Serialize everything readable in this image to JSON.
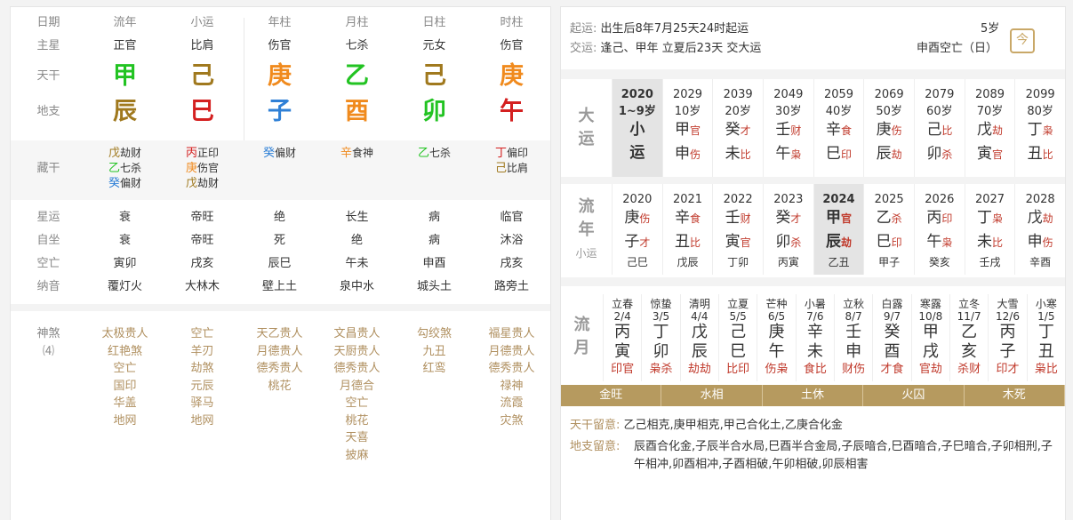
{
  "left": {
    "headers": [
      "日期",
      "流年",
      "小运",
      "年柱",
      "月柱",
      "日柱",
      "时柱"
    ],
    "zhuxing": {
      "label": "主星",
      "values": [
        "正官",
        "比肩",
        "伤官",
        "七杀",
        "元女",
        "伤官"
      ]
    },
    "tiangan": {
      "label": "天干",
      "values": [
        "甲",
        "己",
        "庚",
        "乙",
        "己",
        "庚"
      ],
      "colors": [
        "#22c322",
        "#a0791e",
        "#f08a1d",
        "#22c322",
        "#a0791e",
        "#f08a1d"
      ]
    },
    "dizhi": {
      "label": "地支",
      "values": [
        "辰",
        "巳",
        "子",
        "酉",
        "卯",
        "午"
      ],
      "colors": [
        "#a0791e",
        "#d42020",
        "#2f80d6",
        "#f08a1d",
        "#22c322",
        "#d42020"
      ]
    },
    "canggan": {
      "label": "藏干",
      "cols": [
        [
          {
            "g": "戊",
            "t": "劫财",
            "c": "#a0791e"
          },
          {
            "g": "乙",
            "t": "七杀",
            "c": "#22c322"
          },
          {
            "g": "癸",
            "t": "偏财",
            "c": "#2f80d6"
          }
        ],
        [
          {
            "g": "丙",
            "t": "正印",
            "c": "#d42020"
          },
          {
            "g": "庚",
            "t": "伤官",
            "c": "#f08a1d"
          },
          {
            "g": "戊",
            "t": "劫财",
            "c": "#a0791e"
          }
        ],
        [
          {
            "g": "癸",
            "t": "偏财",
            "c": "#2f80d6"
          }
        ],
        [
          {
            "g": "辛",
            "t": "食神",
            "c": "#f08a1d"
          }
        ],
        [
          {
            "g": "乙",
            "t": "七杀",
            "c": "#22c322"
          }
        ],
        [
          {
            "g": "丁",
            "t": "偏印",
            "c": "#d42020"
          },
          {
            "g": "己",
            "t": "比肩",
            "c": "#a0791e"
          }
        ]
      ]
    },
    "rows": [
      {
        "label": "星运",
        "values": [
          "衰",
          "帝旺",
          "绝",
          "长生",
          "病",
          "临官"
        ]
      },
      {
        "label": "自坐",
        "values": [
          "衰",
          "帝旺",
          "死",
          "绝",
          "病",
          "沐浴"
        ]
      },
      {
        "label": "空亡",
        "values": [
          "寅卯",
          "戌亥",
          "辰巳",
          "午未",
          "申酉",
          "戌亥"
        ]
      },
      {
        "label": "纳音",
        "values": [
          "覆灯火",
          "大林木",
          "壁上土",
          "泉中水",
          "城头土",
          "路旁土"
        ]
      }
    ],
    "shensha": {
      "label": "神煞",
      "sub": "⑷",
      "cols": [
        [
          "太极贵人",
          "红艳煞",
          "空亡",
          "国印",
          "华盖",
          "地网"
        ],
        [
          "空亡",
          "羊刃",
          "劫煞",
          "元辰",
          "驿马",
          "地网"
        ],
        [
          "天乙贵人",
          "月德贵人",
          "德秀贵人",
          "桃花"
        ],
        [
          "文昌贵人",
          "天厨贵人",
          "德秀贵人",
          "月德合",
          "空亡",
          "桃花",
          "天喜",
          "披麻"
        ],
        [
          "勾绞煞",
          "九丑",
          "红鸾"
        ],
        [
          "福星贵人",
          "月德贵人",
          "德秀贵人",
          "禄神",
          "流霞",
          "灾煞"
        ]
      ]
    }
  },
  "right": {
    "qiyun_label": "起运:",
    "qiyun": "出生后8年7月25天24时起运",
    "age": "5岁",
    "jiaoyun_label": "交运:",
    "jiaoyun": "逢己、甲年 立夏后23天 交大运",
    "kongwang": "申酉空亡（日）",
    "jin_icon": "今",
    "dayun_head": [
      "大",
      "运"
    ],
    "dayun": [
      {
        "y": "2020",
        "a": "1~9岁",
        "g1": "小",
        "g2": "运",
        "hl": true
      },
      {
        "y": "2029",
        "a": "10岁",
        "g1": "甲",
        "s1": "官",
        "g2": "申",
        "s2": "伤"
      },
      {
        "y": "2039",
        "a": "20岁",
        "g1": "癸",
        "s1": "才",
        "g2": "未",
        "s2": "比"
      },
      {
        "y": "2049",
        "a": "30岁",
        "g1": "壬",
        "s1": "财",
        "g2": "午",
        "s2": "枭"
      },
      {
        "y": "2059",
        "a": "40岁",
        "g1": "辛",
        "s1": "食",
        "g2": "巳",
        "s2": "印"
      },
      {
        "y": "2069",
        "a": "50岁",
        "g1": "庚",
        "s1": "伤",
        "g2": "辰",
        "s2": "劫"
      },
      {
        "y": "2079",
        "a": "60岁",
        "g1": "己",
        "s1": "比",
        "g2": "卯",
        "s2": "杀"
      },
      {
        "y": "2089",
        "a": "70岁",
        "g1": "戊",
        "s1": "劫",
        "g2": "寅",
        "s2": "官"
      },
      {
        "y": "2099",
        "a": "80岁",
        "g1": "丁",
        "s1": "枭",
        "g2": "丑",
        "s2": "比"
      }
    ],
    "liunian_head": [
      "流",
      "年"
    ],
    "liunian_sub": "小运",
    "liunian": [
      {
        "y": "2020",
        "g1": "庚",
        "s1": "伤",
        "g2": "子",
        "s2": "才",
        "x": "己巳"
      },
      {
        "y": "2021",
        "g1": "辛",
        "s1": "食",
        "g2": "丑",
        "s2": "比",
        "x": "戊辰"
      },
      {
        "y": "2022",
        "g1": "壬",
        "s1": "财",
        "g2": "寅",
        "s2": "官",
        "x": "丁卯"
      },
      {
        "y": "2023",
        "g1": "癸",
        "s1": "才",
        "g2": "卯",
        "s2": "杀",
        "x": "丙寅"
      },
      {
        "y": "2024",
        "g1": "甲",
        "s1": "官",
        "g2": "辰",
        "s2": "劫",
        "x": "乙丑",
        "hl": true
      },
      {
        "y": "2025",
        "g1": "乙",
        "s1": "杀",
        "g2": "巳",
        "s2": "印",
        "x": "甲子"
      },
      {
        "y": "2026",
        "g1": "丙",
        "s1": "印",
        "g2": "午",
        "s2": "枭",
        "x": "癸亥"
      },
      {
        "y": "2027",
        "g1": "丁",
        "s1": "枭",
        "g2": "未",
        "s2": "比",
        "x": "壬戌"
      },
      {
        "y": "2028",
        "g1": "戊",
        "s1": "劫",
        "g2": "申",
        "s2": "伤",
        "x": "辛酉"
      }
    ],
    "liuyue_head": [
      "流",
      "月"
    ],
    "liuyue": [
      {
        "j": "立春",
        "d": "2/4",
        "g1": "丙",
        "g2": "寅",
        "s": "印官"
      },
      {
        "j": "惊蛰",
        "d": "3/5",
        "g1": "丁",
        "g2": "卯",
        "s": "枭杀"
      },
      {
        "j": "清明",
        "d": "4/4",
        "g1": "戊",
        "g2": "辰",
        "s": "劫劫"
      },
      {
        "j": "立夏",
        "d": "5/5",
        "g1": "己",
        "g2": "巳",
        "s": "比印"
      },
      {
        "j": "芒种",
        "d": "6/5",
        "g1": "庚",
        "g2": "午",
        "s": "伤枭"
      },
      {
        "j": "小暑",
        "d": "7/6",
        "g1": "辛",
        "g2": "未",
        "s": "食比"
      },
      {
        "j": "立秋",
        "d": "8/7",
        "g1": "壬",
        "g2": "申",
        "s": "财伤"
      },
      {
        "j": "白露",
        "d": "9/7",
        "g1": "癸",
        "g2": "酉",
        "s": "才食"
      },
      {
        "j": "寒露",
        "d": "10/8",
        "g1": "甲",
        "g2": "戌",
        "s": "官劫"
      },
      {
        "j": "立冬",
        "d": "11/7",
        "g1": "乙",
        "g2": "亥",
        "s": "杀财"
      },
      {
        "j": "大雪",
        "d": "12/6",
        "g1": "丙",
        "g2": "子",
        "s": "印才"
      },
      {
        "j": "小寒",
        "d": "1/5",
        "g1": "丁",
        "g2": "丑",
        "s": "枭比"
      }
    ],
    "wuxing": [
      "金旺",
      "水相",
      "土休",
      "火囚",
      "木死"
    ],
    "tiangan_note_label": "天干留意:",
    "tiangan_note": "乙己相克,庚甲相克,甲己合化土,乙庚合化金",
    "dizhi_note_label": "地支留意:",
    "dizhi_note": "辰酉合化金,子辰半合水局,巳酉半合金局,子辰暗合,巳酉暗合,子巳暗合,子卯相刑,子午相冲,卯酉相冲,子酉相破,午卯相破,卯辰相害"
  }
}
